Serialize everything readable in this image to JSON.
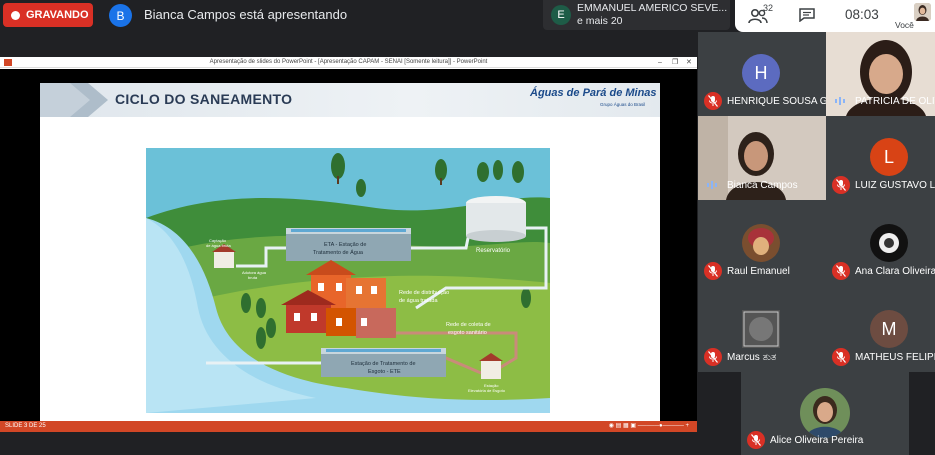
{
  "top": {
    "recording_label": "GRAVANDO",
    "presenter_initial": "B",
    "presenter_text": "Bianca Campos está apresentando"
  },
  "notification": {
    "initial": "E",
    "line1": "EMMANUEL AMERICO SEVE...",
    "line2": "e mais 20"
  },
  "controls": {
    "participant_count": "32",
    "time": "08:03",
    "self_label": "Você"
  },
  "presentation": {
    "window_title": "Apresentação de slides do PowerPoint - [Apresentação CAPAM - SENAI [Somente leitura]] - PowerPoint",
    "slide_title": "CICLO DO SANEAMENTO",
    "brand": "Águas de Pará de Minas",
    "brand_sub": "Grupo Águas do Brasil",
    "status_left": "SLIDE 3 DE 25",
    "labels": {
      "captacao": [
        "Captação",
        "de água bruta"
      ],
      "adutora": [
        "Adutora água",
        "bruta"
      ],
      "eta": [
        "ETA - Estação de",
        "Tratamento de Água"
      ],
      "reservatorio": "Reservatório",
      "distribuicao": [
        "Rede de distribuição",
        "de água tratada"
      ],
      "coleta": [
        "Rede de coleta de",
        "esgoto sanitário"
      ],
      "ete": [
        "Estação de Tratamento de",
        "Esgoto - ETE"
      ],
      "elevatoria": [
        "Estação",
        "Elevatória de Esgoto"
      ]
    }
  },
  "participants": [
    {
      "name": "HENRIQUE SOUSA G...",
      "initial": "H",
      "color": "#5c6bc0",
      "type": "avatar",
      "mic": "off"
    },
    {
      "name": "PATRICIA DE OLIVE...",
      "type": "video",
      "mic": "on"
    },
    {
      "name": "Bianca Campos",
      "type": "video",
      "mic": "on"
    },
    {
      "name": "LUIZ GUSTAVO LAC...",
      "initial": "L",
      "color": "#d84315",
      "type": "avatar",
      "mic": "off"
    },
    {
      "name": "Raul Emanuel",
      "type": "photo",
      "mic": "off"
    },
    {
      "name": "Ana Clara Oliveira F...",
      "type": "photo",
      "mic": "off"
    },
    {
      "name": "Marcus ತುತ",
      "type": "photo",
      "mic": "off"
    },
    {
      "name": "MATHEUS FELIPE ...",
      "initial": "M",
      "color": "#6d4c41",
      "type": "avatar",
      "mic": "off"
    },
    {
      "name": "Alice Oliveira Pereira",
      "type": "photo",
      "mic": "off"
    }
  ]
}
